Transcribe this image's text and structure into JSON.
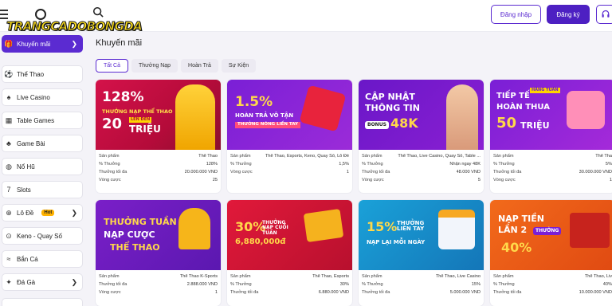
{
  "header": {
    "logo_text": "TRANGCADOBONGDA",
    "login_label": "Đăng nhập",
    "register_label": "Đăng ký"
  },
  "sidebar": {
    "items": [
      {
        "label": "Khuyến mãi",
        "icon": "gift-icon"
      },
      {
        "label": "Thể Thao",
        "icon": "soccer-ball-icon"
      },
      {
        "label": "Live Casino",
        "icon": "cards-icon"
      },
      {
        "label": "Table Games",
        "icon": "table-icon"
      },
      {
        "label": "Game Bài",
        "icon": "card-game-icon"
      },
      {
        "label": "Nổ Hũ",
        "icon": "slot-jar-icon"
      },
      {
        "label": "Slots",
        "icon": "slot-icon"
      },
      {
        "label": "Lô Đề",
        "icon": "lottery-icon",
        "badge": "Hot"
      },
      {
        "label": "Keno - Quay Số",
        "icon": "keno-icon"
      },
      {
        "label": "Bắn Cá",
        "icon": "fish-icon"
      },
      {
        "label": "Đá Gà",
        "icon": "rooster-icon"
      }
    ]
  },
  "main": {
    "title": "Khuyến mãi",
    "tabs": [
      "Tất Cả",
      "Thưởng Nạp",
      "Hoàn Trả",
      "Sự Kiện"
    ],
    "cards": [
      {
        "banner": {
          "l1": "128%",
          "l2": "THƯỞNG NẠP THỂ THAO",
          "l3": "20",
          "l4": "TRIỆU",
          "tag": "LÊN ĐẾN"
        },
        "product": "Thể Thao",
        "bonus": "128%",
        "max": "20.000.000 VND",
        "rounds": "25"
      },
      {
        "banner": {
          "l1": "1.5%",
          "l2": "HOÀN TRẢ VÔ TẬN",
          "l3": "THƯỞNG NÓNG LIỀN TAY"
        },
        "product": "Thể Thao, Esports, Keno, Quay Số, Lô Đề",
        "bonus": "1,5%",
        "rounds": "1"
      },
      {
        "banner": {
          "l1": "CẬP NHẬT",
          "l2": "THÔNG TIN",
          "l3": "BONUS",
          "l4": "48K"
        },
        "product": "Thể Thao, Live Casino, Quay Số, Table ...",
        "bonus": "Nhận ngay 48K",
        "max": "48.000 VND",
        "rounds": "5"
      },
      {
        "banner": {
          "l1": "TIẾP TẾ",
          "l2": "HOÀN THUA",
          "l3": "50",
          "l4": "TRIỆU",
          "tag": "HẰNG TUẦN"
        },
        "product": "Thể Tha",
        "bonus": "5%",
        "max": "30.000.000 VND",
        "rounds": "1"
      },
      {
        "banner": {
          "l1": "THƯỞNG TUẦN",
          "l2": "NẠP CƯỢC",
          "l3": "THỂ THAO"
        },
        "product": "Thể Thao K-Sports",
        "max": "2.888.000 VND",
        "rounds": "1"
      },
      {
        "banner": {
          "l1": "30%",
          "l2": "THƯỞNG NẠP CUỐI TUẦN",
          "l3": "6,880,000đ"
        },
        "product": "Thể Thao, Esports",
        "bonus": "30%",
        "max": "6.880.000 VND"
      },
      {
        "banner": {
          "l1": "15%",
          "l2": "THƯỞNG LIÊN TAY",
          "l3": "NẠP LẠI MỖI NGÀY"
        },
        "product": "Thể Thao, Live Casino",
        "bonus": "15%",
        "max": "5.000.000 VND"
      },
      {
        "banner": {
          "l1": "NẠP TIỀN",
          "l2": "LẦN 2",
          "l3": "40%",
          "tag": "THƯỞNG"
        },
        "product": "Thể Thao, Liv",
        "bonus": "40%",
        "max": "10.000.000 VND"
      }
    ],
    "info_labels": {
      "product": "Sản phẩm",
      "bonus": "% Thưởng",
      "max": "Thưởng tối đa",
      "rounds": "Vòng cược"
    }
  }
}
